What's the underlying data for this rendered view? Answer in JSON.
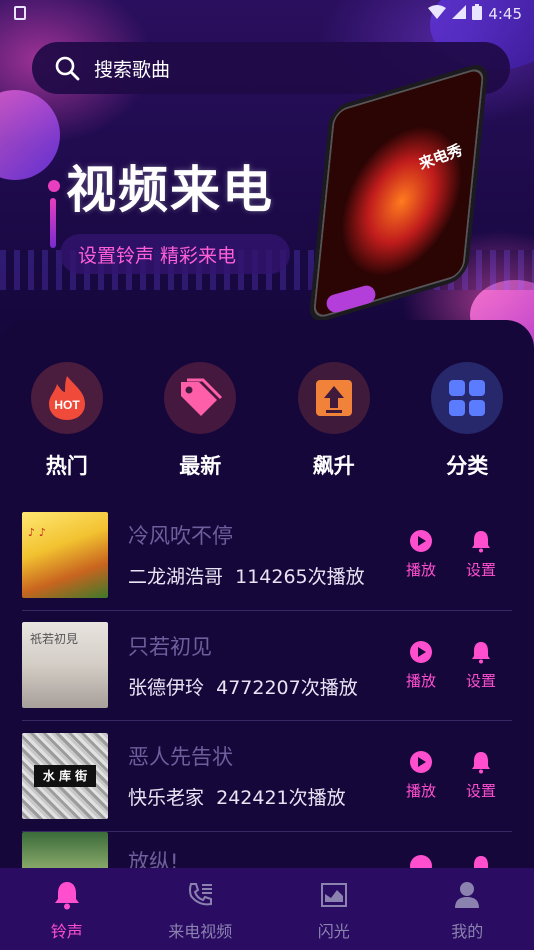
{
  "status_bar": {
    "time": "4:45"
  },
  "search": {
    "placeholder": "搜索歌曲"
  },
  "hero": {
    "title": "视频来电",
    "subtitle": "设置铃声 精彩来电",
    "phone_label": "来电秀"
  },
  "categories": [
    {
      "label": "热门",
      "icon": "hot-icon",
      "badge": "HOT"
    },
    {
      "label": "最新",
      "icon": "tag-icon"
    },
    {
      "label": "飙升",
      "icon": "rise-icon"
    },
    {
      "label": "分类",
      "icon": "grid-icon"
    }
  ],
  "songs": [
    {
      "title": "冷风吹不停",
      "artist": "二龙湖浩哥",
      "plays": "114265次播放",
      "play_label": "播放",
      "set_label": "设置"
    },
    {
      "title": "只若初见",
      "artist": "张德伊玲",
      "plays": "4772207次播放",
      "play_label": "播放",
      "set_label": "设置",
      "cover_text": "祇若初見"
    },
    {
      "title": "恶人先告状",
      "artist": "快乐老家",
      "plays": "242421次播放",
      "play_label": "播放",
      "set_label": "设置",
      "cover_text": "水 库 街"
    },
    {
      "title": "放纵!",
      "play_label": "",
      "set_label": ""
    }
  ],
  "tabbar": {
    "items": [
      {
        "label": "铃声",
        "icon": "bell-icon",
        "active": true
      },
      {
        "label": "来电视频",
        "icon": "phone-list-icon",
        "active": false
      },
      {
        "label": "闪光",
        "icon": "flash-chart-icon",
        "active": false
      },
      {
        "label": "我的",
        "icon": "user-icon",
        "active": false
      }
    ]
  },
  "colors": {
    "accent": "#ff4fcf",
    "background": "#16073b",
    "tabbar": "#2a0c63"
  }
}
